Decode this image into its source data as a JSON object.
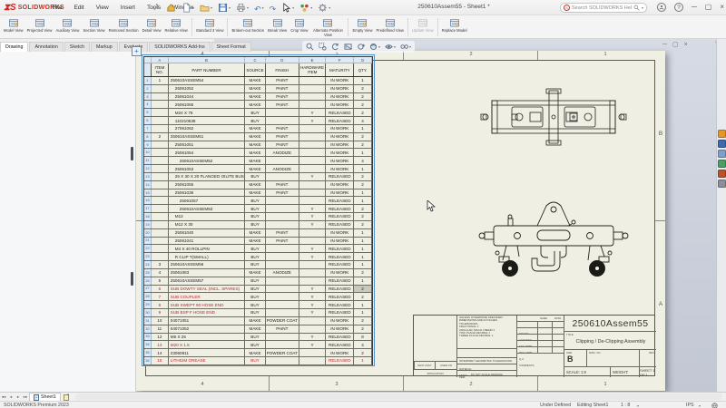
{
  "titlebar": {
    "logo": "SOLIDWORKS",
    "menus": [
      "File",
      "Edit",
      "View",
      "Insert",
      "Tools",
      "Window"
    ],
    "quick_access": [
      "home",
      "new",
      "open",
      "save",
      "print",
      "undo",
      "redo",
      "select",
      "display",
      "options"
    ],
    "title": "250610Assem55 - Sheet1 *",
    "search_placeholder": "Search SOLIDWORKS Help",
    "help_glyph": "?"
  },
  "ribbon": {
    "items": [
      {
        "t": "b",
        "label": "Model View"
      },
      {
        "t": "b",
        "label": "Projected View"
      },
      {
        "t": "b",
        "label": "Auxiliary View"
      },
      {
        "t": "b",
        "label": "Section View"
      },
      {
        "t": "b",
        "label": "Removed Section"
      },
      {
        "t": "b",
        "label": "Detail View"
      },
      {
        "t": "b",
        "label": "Relative View"
      },
      {
        "t": "s"
      },
      {
        "t": "b",
        "label": "Standard 3 View"
      },
      {
        "t": "s"
      },
      {
        "t": "b",
        "label": "Broken-out Section"
      },
      {
        "t": "b",
        "label": "Break View"
      },
      {
        "t": "b",
        "label": "Crop View"
      },
      {
        "t": "b",
        "label": "Alternate Position View"
      },
      {
        "t": "s"
      },
      {
        "t": "b",
        "label": "Empty View"
      },
      {
        "t": "b",
        "label": "Predefined View"
      },
      {
        "t": "s"
      },
      {
        "t": "b",
        "label": "Update View",
        "disabled": true
      },
      {
        "t": "s"
      },
      {
        "t": "b",
        "label": "Replace Model"
      }
    ]
  },
  "tabs": {
    "active_index": 0,
    "items": [
      "Drawing",
      "Annotation",
      "Sketch",
      "Markup",
      "Evaluate",
      "SOLIDWORKS Add-Ins",
      "Sheet Format"
    ]
  },
  "headsup": {
    "items": [
      "zoom-to-fit",
      "zoom-to-area",
      "previous-view",
      "section-view",
      "rotate-view",
      "appearance-settings",
      "view-settings",
      "hide-show-items"
    ]
  },
  "taskpane": {
    "items": [
      "solidworks-resources",
      "design-library",
      "file-explorer",
      "view-palette",
      "appearances-scenes",
      "custom-properties"
    ]
  },
  "bom": {
    "column_letters": [
      "A",
      "B",
      "C",
      "D",
      "E",
      "F",
      "G"
    ],
    "headers": [
      [
        "ITEM",
        "NO."
      ],
      [
        "PART NUMBER"
      ],
      [
        "SOURCE"
      ],
      [
        "FINISH"
      ],
      [
        "HARDWARE",
        "ITEM"
      ],
      [
        "MATURITY"
      ],
      [
        "QTY."
      ]
    ],
    "rows": [
      {
        "n": 1,
        "item": "1",
        "part": "250610ASSEM54",
        "src": "MAKE",
        "fin": "PAINT",
        "hw": "",
        "mat": "IN WORK",
        "qty": "1",
        "red": 0,
        "ind": 0,
        "shade": false
      },
      {
        "n": 2,
        "item": "",
        "part": "25061052",
        "src": "MAKE",
        "fin": "PAINT",
        "hw": "",
        "mat": "IN WORK",
        "qty": "2",
        "red": 0,
        "ind": 1,
        "shade": false
      },
      {
        "n": 3,
        "item": "",
        "part": "25061044",
        "src": "MAKE",
        "fin": "PAINT",
        "hw": "",
        "mat": "IN WORK",
        "qty": "2",
        "red": 0,
        "ind": 1,
        "shade": false
      },
      {
        "n": 4,
        "item": "",
        "part": "25061065",
        "src": "MAKE",
        "fin": "PAINT",
        "hw": "",
        "mat": "IN WORK",
        "qty": "2",
        "red": 0,
        "ind": 1,
        "shade": false
      },
      {
        "n": 5,
        "item": "",
        "part": "M24 X 75",
        "src": "BUY",
        "fin": "",
        "hw": "Y",
        "mat": "RELEASED",
        "qty": "2",
        "red": 0,
        "ind": 1,
        "shade": false
      },
      {
        "n": 6,
        "item": "",
        "part": "110210538",
        "src": "BUY",
        "fin": "",
        "hw": "Y",
        "mat": "RELEASED",
        "qty": "4",
        "red": 0,
        "ind": 1,
        "shade": false
      },
      {
        "n": 7,
        "item": "",
        "part": "27061062",
        "src": "MAKE",
        "fin": "PAINT",
        "hw": "",
        "mat": "IN WORK",
        "qty": "1",
        "red": 0,
        "ind": 1,
        "shade": false
      },
      {
        "n": 8,
        "item": "2",
        "part": "250610ASSEM51",
        "src": "MAKE",
        "fin": "PAINT",
        "hw": "",
        "mat": "IN WORK",
        "qty": "2",
        "red": 0,
        "ind": 0,
        "shade": false
      },
      {
        "n": 9,
        "item": "",
        "part": "25061051",
        "src": "MAKE",
        "fin": "PAINT",
        "hw": "",
        "mat": "IN WORK",
        "qty": "2",
        "red": 0,
        "ind": 1,
        "shade": false
      },
      {
        "n": 10,
        "item": "",
        "part": "25061054",
        "src": "MAKE",
        "fin": "ANODIZE",
        "hw": "",
        "mat": "IN WORK",
        "qty": "1",
        "red": 0,
        "ind": 1,
        "shade": false
      },
      {
        "n": 11,
        "item": "",
        "part": "250610ASSEM52",
        "src": "MAKE",
        "fin": "",
        "hw": "",
        "mat": "IN WORK",
        "qty": "4",
        "red": 0,
        "ind": 2,
        "shade": false
      },
      {
        "n": 12,
        "item": "",
        "part": "25061053",
        "src": "MAKE",
        "fin": "ANODIZE",
        "hw": "",
        "mat": "IN WORK",
        "qty": "1",
        "red": 0,
        "ind": 1,
        "shade": false
      },
      {
        "n": 13,
        "item": "",
        "part": "25 X 30 X 20 FLANGED OILITE BUSH",
        "src": "BUY",
        "fin": "",
        "hw": "Y",
        "mat": "RELEASED",
        "qty": "2",
        "red": 0,
        "ind": 1,
        "shade": false
      },
      {
        "n": 14,
        "item": "",
        "part": "25061055",
        "src": "MAKE",
        "fin": "PAINT",
        "hw": "",
        "mat": "IN WORK",
        "qty": "2",
        "red": 0,
        "ind": 1,
        "shade": false
      },
      {
        "n": 15,
        "item": "",
        "part": "25061036",
        "src": "MAKE",
        "fin": "PAINT",
        "hw": "",
        "mat": "IN WORK",
        "qty": "1",
        "red": 0,
        "ind": 1,
        "shade": false
      },
      {
        "n": 16,
        "item": "",
        "part": "25061057",
        "src": "BUY",
        "fin": "",
        "hw": "",
        "mat": "RELEASED",
        "qty": "1",
        "red": 0,
        "ind": 2,
        "shade": false
      },
      {
        "n": 17,
        "item": "",
        "part": "250610ASSEM53",
        "src": "BUY",
        "fin": "",
        "hw": "Y",
        "mat": "RELEASED",
        "qty": "2",
        "red": 0,
        "ind": 2,
        "shade": false
      },
      {
        "n": 18,
        "item": "",
        "part": "M12",
        "src": "BUY",
        "fin": "",
        "hw": "Y",
        "mat": "RELEASED",
        "qty": "2",
        "red": 0,
        "ind": 1,
        "shade": false
      },
      {
        "n": 19,
        "item": "",
        "part": "M12 X 30",
        "src": "BUY",
        "fin": "",
        "hw": "Y",
        "mat": "RELEASED",
        "qty": "2",
        "red": 0,
        "ind": 1,
        "shade": false
      },
      {
        "n": 20,
        "item": "",
        "part": "25061040",
        "src": "MAKE",
        "fin": "PAINT",
        "hw": "",
        "mat": "IN WORK",
        "qty": "1",
        "red": 0,
        "ind": 1,
        "shade": false
      },
      {
        "n": 21,
        "item": "",
        "part": "25061041",
        "src": "MAKE",
        "fin": "PAINT",
        "hw": "",
        "mat": "IN WORK",
        "qty": "1",
        "red": 0,
        "ind": 1,
        "shade": false
      },
      {
        "n": 22,
        "item": "",
        "part": "M4 X 40 ROLLPIN",
        "src": "BUY",
        "fin": "",
        "hw": "Y",
        "mat": "RELEASED",
        "qty": "1",
        "red": 0,
        "ind": 1,
        "shade": false
      },
      {
        "n": 23,
        "item": "",
        "part": "R CLIP T(SMALL)",
        "src": "BUY",
        "fin": "",
        "hw": "Y",
        "mat": "RELEASED",
        "qty": "1",
        "red": 0,
        "ind": 1,
        "shade": false
      },
      {
        "n": 24,
        "item": "3",
        "part": "250610ASSEM56",
        "src": "BUY",
        "fin": "",
        "hw": "",
        "mat": "RELEASED",
        "qty": "1",
        "red": 0,
        "ind": 0,
        "shade": false
      },
      {
        "n": 25,
        "item": "4",
        "part": "25061063",
        "src": "MAKE",
        "fin": "ANODIZE",
        "hw": "",
        "mat": "IN WORK",
        "qty": "2",
        "red": 0,
        "ind": 0,
        "shade": false
      },
      {
        "n": 26,
        "item": "5",
        "part": "250610ASSEM57",
        "src": "BUY",
        "fin": "",
        "hw": "",
        "mat": "RELEASED",
        "qty": "1",
        "red": 0,
        "ind": 0,
        "shade": false
      },
      {
        "n": 27,
        "item": "6",
        "part": "SUB DOWTY SEAL (INCL. SPARES)",
        "src": "BUY",
        "fin": "",
        "hw": "Y",
        "mat": "RELEASED",
        "qty": "2",
        "red": 1,
        "ind": 0,
        "shade": true
      },
      {
        "n": 28,
        "item": "7",
        "part": "SUB COUPLER",
        "src": "BUY",
        "fin": "",
        "hw": "Y",
        "mat": "RELEASED",
        "qty": "2",
        "red": 1,
        "ind": 0,
        "shade": false
      },
      {
        "n": 29,
        "item": "8",
        "part": "SUB SWEPT 90 HOSE END",
        "src": "BUY",
        "fin": "",
        "hw": "Y",
        "mat": "RELEASED",
        "qty": "1",
        "red": 1,
        "ind": 0,
        "shade": false
      },
      {
        "n": 30,
        "item": "9",
        "part": "SUB BSP F HOSE END",
        "src": "BUY",
        "fin": "",
        "hw": "Y",
        "mat": "RELEASED",
        "qty": "1",
        "red": 1,
        "ind": 0,
        "shade": false
      },
      {
        "n": 31,
        "item": "10",
        "part": "04071051",
        "src": "MAKE",
        "fin": "POWDER COAT",
        "hw": "",
        "mat": "IN WORK",
        "qty": "2",
        "red": 0,
        "ind": 0,
        "shade": false
      },
      {
        "n": 32,
        "item": "11",
        "part": "04071052",
        "src": "MAKE",
        "fin": "PAINT",
        "hw": "",
        "mat": "IN WORK",
        "qty": "2",
        "red": 0,
        "ind": 0,
        "shade": false
      },
      {
        "n": 33,
        "item": "12",
        "part": "M6 X 25",
        "src": "BUY",
        "fin": "",
        "hw": "Y",
        "mat": "RELEASED",
        "qty": "8",
        "red": 0,
        "ind": 0,
        "shade": false
      },
      {
        "n": 34,
        "item": "13",
        "part": "M20 X 1.5",
        "src": "BUY",
        "fin": "",
        "hw": "Y",
        "mat": "RELEASED",
        "qty": "4",
        "red": 1,
        "ind": 0,
        "shade": false
      },
      {
        "n": 35,
        "item": "14",
        "part": "23060811",
        "src": "MAKE",
        "fin": "POWDER COAT",
        "hw": "",
        "mat": "IN WORK",
        "qty": "2",
        "red": 0,
        "ind": 0,
        "shade": false
      },
      {
        "n": 36,
        "item": "15",
        "part": "LITHIUM GREASE",
        "src": "BUY",
        "fin": "",
        "hw": "",
        "mat": "RELEASED",
        "qty": "1",
        "red": 2,
        "ind": 0,
        "shade": false
      }
    ]
  },
  "sheet": {
    "zones_top": [
      "4",
      "3",
      "2",
      "1"
    ],
    "zones_bottom": [
      "4",
      "3",
      "2",
      "1"
    ],
    "zone_letters_right": [
      "B",
      "A"
    ]
  },
  "titleblock": {
    "drawing_number_large": "250610Assem55",
    "title_label": "TITLE:",
    "title": "Clipping / De-Clipping Assembly",
    "size_label": "SIZE",
    "size": "B",
    "dwg_label": "DWG.  NO.",
    "rev_label": "REV",
    "scale": "SCALE: 1:8",
    "weight": "WEIGHT:",
    "sheet": "SHEET 1 OF 1",
    "name_label": "NAME",
    "date_label": "DATE",
    "approval_rows": [
      "DRAWN",
      "CHECKED",
      "ENG APPR.",
      "MFG APPR.",
      "Q.A.",
      "COMMENTS:"
    ],
    "notes": [
      "UNLESS OTHERWISE SPECIFIED:",
      "DIMENSIONS ARE IN INCHES",
      "TOLERANCES:",
      "FRACTIONAL ±",
      "ANGULAR: MACH ±   BEND ±",
      "TWO PLACE DECIMAL    ±",
      "THREE PLACE DECIMAL  ±"
    ],
    "interpret": "INTERPRET GEOMETRIC TOLERANCING PER:",
    "material_label": "MATERIAL",
    "finish_label": "FINISH",
    "next_assy": "NEXT ASSY",
    "used_on": "USED ON",
    "application": "APPLICATION",
    "do_not_scale": "DO NOT SCALE DRAWING"
  },
  "sheettabs": {
    "active": "Sheet1"
  },
  "statusbar": {
    "product": "SOLIDWORKS Premium 2023",
    "defined": "Under Defined",
    "editing": "Editing Sheet1",
    "scale": "1 : 8",
    "units": "IPS"
  }
}
